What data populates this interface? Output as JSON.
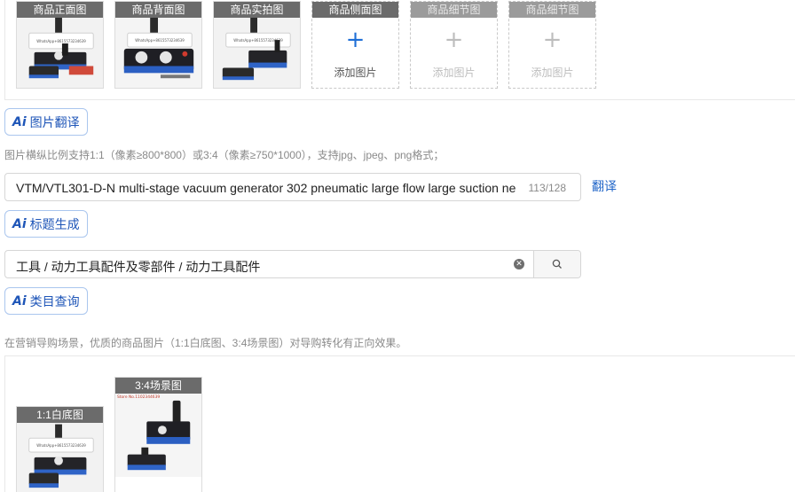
{
  "images": {
    "slots": [
      {
        "caption": "商品正面图",
        "state": "filled"
      },
      {
        "caption": "商品背面图",
        "state": "filled"
      },
      {
        "caption": "商品实拍图",
        "state": "filled"
      },
      {
        "caption": "商品侧面图",
        "state": "add",
        "add_label": "添加图片"
      },
      {
        "caption": "商品细节图",
        "state": "disabled",
        "add_label": "添加图片"
      },
      {
        "caption": "商品细节图",
        "state": "disabled",
        "add_label": "添加图片"
      }
    ],
    "watermark": "WhatsApp+8615573234639"
  },
  "image_translate": {
    "ai": "Ai",
    "label": "图片翻译"
  },
  "image_hint": "图片横纵比例支持1:1（像素≥800*800）或3:4（像素≥750*1000），支持jpg、jpeg、png格式；",
  "title_field": {
    "value": "VTM/VTL301-D-N multi-stage vacuum generator 302 pneumatic large flow large suction ne",
    "count": "113/128",
    "translate_link": "翻译"
  },
  "title_generate": {
    "ai": "Ai",
    "label": "标题生成"
  },
  "category_field": {
    "value": "工具 / 动力工具配件及零部件 / 动力工具配件",
    "clear_icon": "✕"
  },
  "category_query": {
    "ai": "Ai",
    "label": "类目查询"
  },
  "marketing_hint": "在营销导购场景，优质的商品图片（1:1白底图、3:4场景图）对导购转化有正向效果。",
  "marketing_images": [
    {
      "caption": "1:1白底图"
    },
    {
      "caption": "3:4场景图",
      "store_text": "Store No.1102344639"
    }
  ],
  "colors": {
    "accent": "#1f56b8",
    "link": "#2166c8",
    "caption_bg": "#6b6b6b"
  }
}
